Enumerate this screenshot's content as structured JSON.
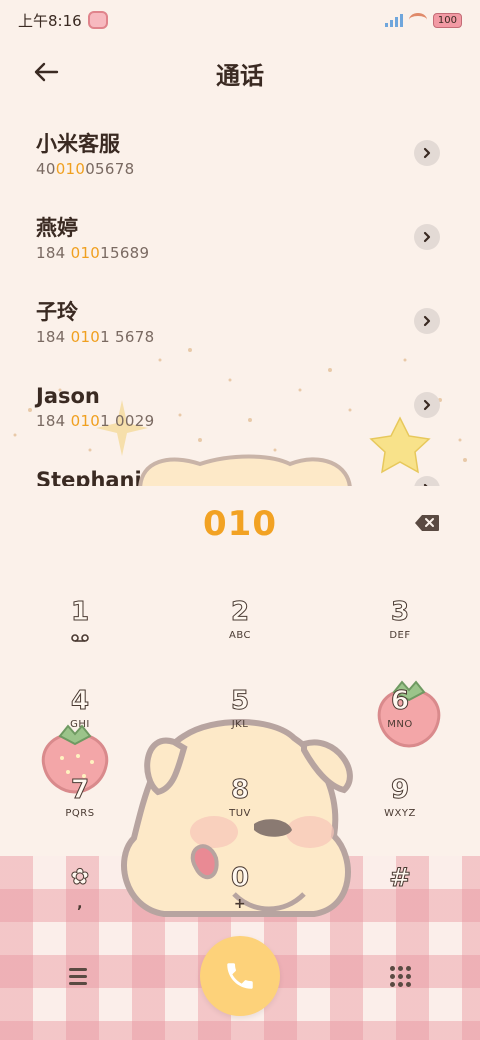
{
  "status_bar": {
    "time": "上午8:16",
    "battery": "100"
  },
  "header": {
    "title": "通话"
  },
  "contacts": [
    {
      "name": "小米客服",
      "number_pre": "40",
      "number_hl": "010",
      "number_post": "05678"
    },
    {
      "name": "燕婷",
      "number_pre": "184 ",
      "number_hl": "010",
      "number_post": "15689"
    },
    {
      "name": "子玲",
      "number_pre": "184 ",
      "number_hl": "010",
      "number_post": "1 5678"
    },
    {
      "name": "Jason",
      "number_pre": "184 ",
      "number_hl": "010",
      "number_post": "1 0029"
    },
    {
      "name": "Stephanie",
      "number_pre": "",
      "number_hl": "",
      "number_post": ""
    }
  ],
  "dialer": {
    "digits": "010"
  },
  "keypad": [
    {
      "digit": "1",
      "letters": "voicemail-icon"
    },
    {
      "digit": "2",
      "letters": "ABC"
    },
    {
      "digit": "3",
      "letters": "DEF"
    },
    {
      "digit": "4",
      "letters": "GHI"
    },
    {
      "digit": "5",
      "letters": "JKL"
    },
    {
      "digit": "6",
      "letters": "MNO"
    },
    {
      "digit": "7",
      "letters": "PQRS"
    },
    {
      "digit": "8",
      "letters": "TUV"
    },
    {
      "digit": "9",
      "letters": "WXYZ"
    },
    {
      "digit": "✿",
      "letters": ","
    },
    {
      "digit": "0",
      "letters": "+"
    },
    {
      "digit": "#",
      "letters": ""
    }
  ],
  "colors": {
    "accent": "#f2a223",
    "call_button": "#fdd27a",
    "background": "#fbf1ea",
    "checker": "#e996a0"
  }
}
